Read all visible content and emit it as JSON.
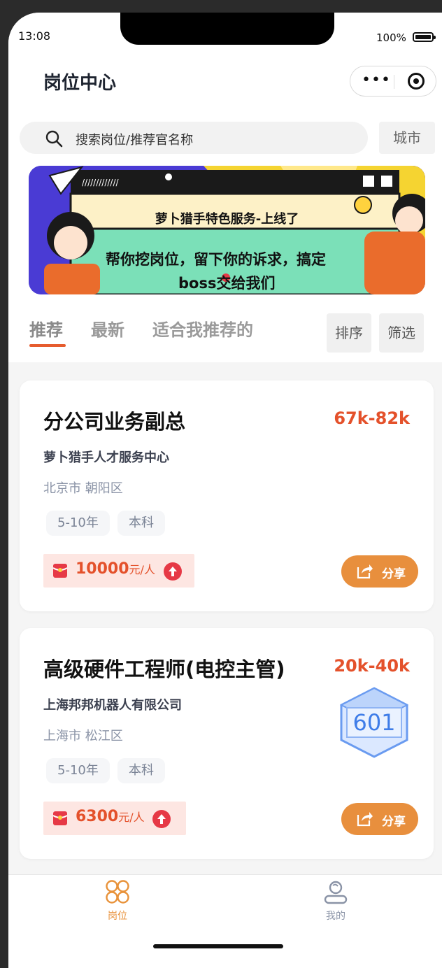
{
  "status": {
    "time": "13:08",
    "battery": "100%"
  },
  "header": {
    "title": "岗位中心"
  },
  "search": {
    "placeholder": "搜索岗位/推荐官名称",
    "city_label": "城市"
  },
  "banner": {
    "line1": "萝卜猎手特色服务-上线了",
    "line2": "帮你挖岗位，留下你的诉求，搞定",
    "line3": "boss交给我们"
  },
  "tabs": {
    "items": [
      "推荐",
      "最新",
      "适合我推荐的"
    ],
    "active": "推荐",
    "sort_label": "排序",
    "filter_label": "筛选"
  },
  "jobs": [
    {
      "title": "分公司业务副总",
      "salary": "67k-82k",
      "company": "萝卜猎手人才服务中心",
      "location": "北京市 朝阳区",
      "tags": [
        "5-10年",
        "本科"
      ],
      "reward_amount": "10000",
      "reward_unit": "元/人",
      "share_label": "分享"
    },
    {
      "title": "高级硬件工程师(电控主管)",
      "salary": "20k-40k",
      "company": "上海邦邦机器人有限公司",
      "location": "上海市 松江区",
      "tags": [
        "5-10年",
        "本科"
      ],
      "reward_amount": "6300",
      "reward_unit": "元/人",
      "share_label": "分享",
      "badge": "601"
    }
  ],
  "tabbar": {
    "items": [
      {
        "label": "岗位",
        "icon": "grid-icon",
        "active": true
      },
      {
        "label": "我的",
        "icon": "user-icon",
        "active": false
      }
    ]
  },
  "colors": {
    "accent": "#e4512b",
    "share": "#e88f3d",
    "tab_active": "#e8923a"
  }
}
